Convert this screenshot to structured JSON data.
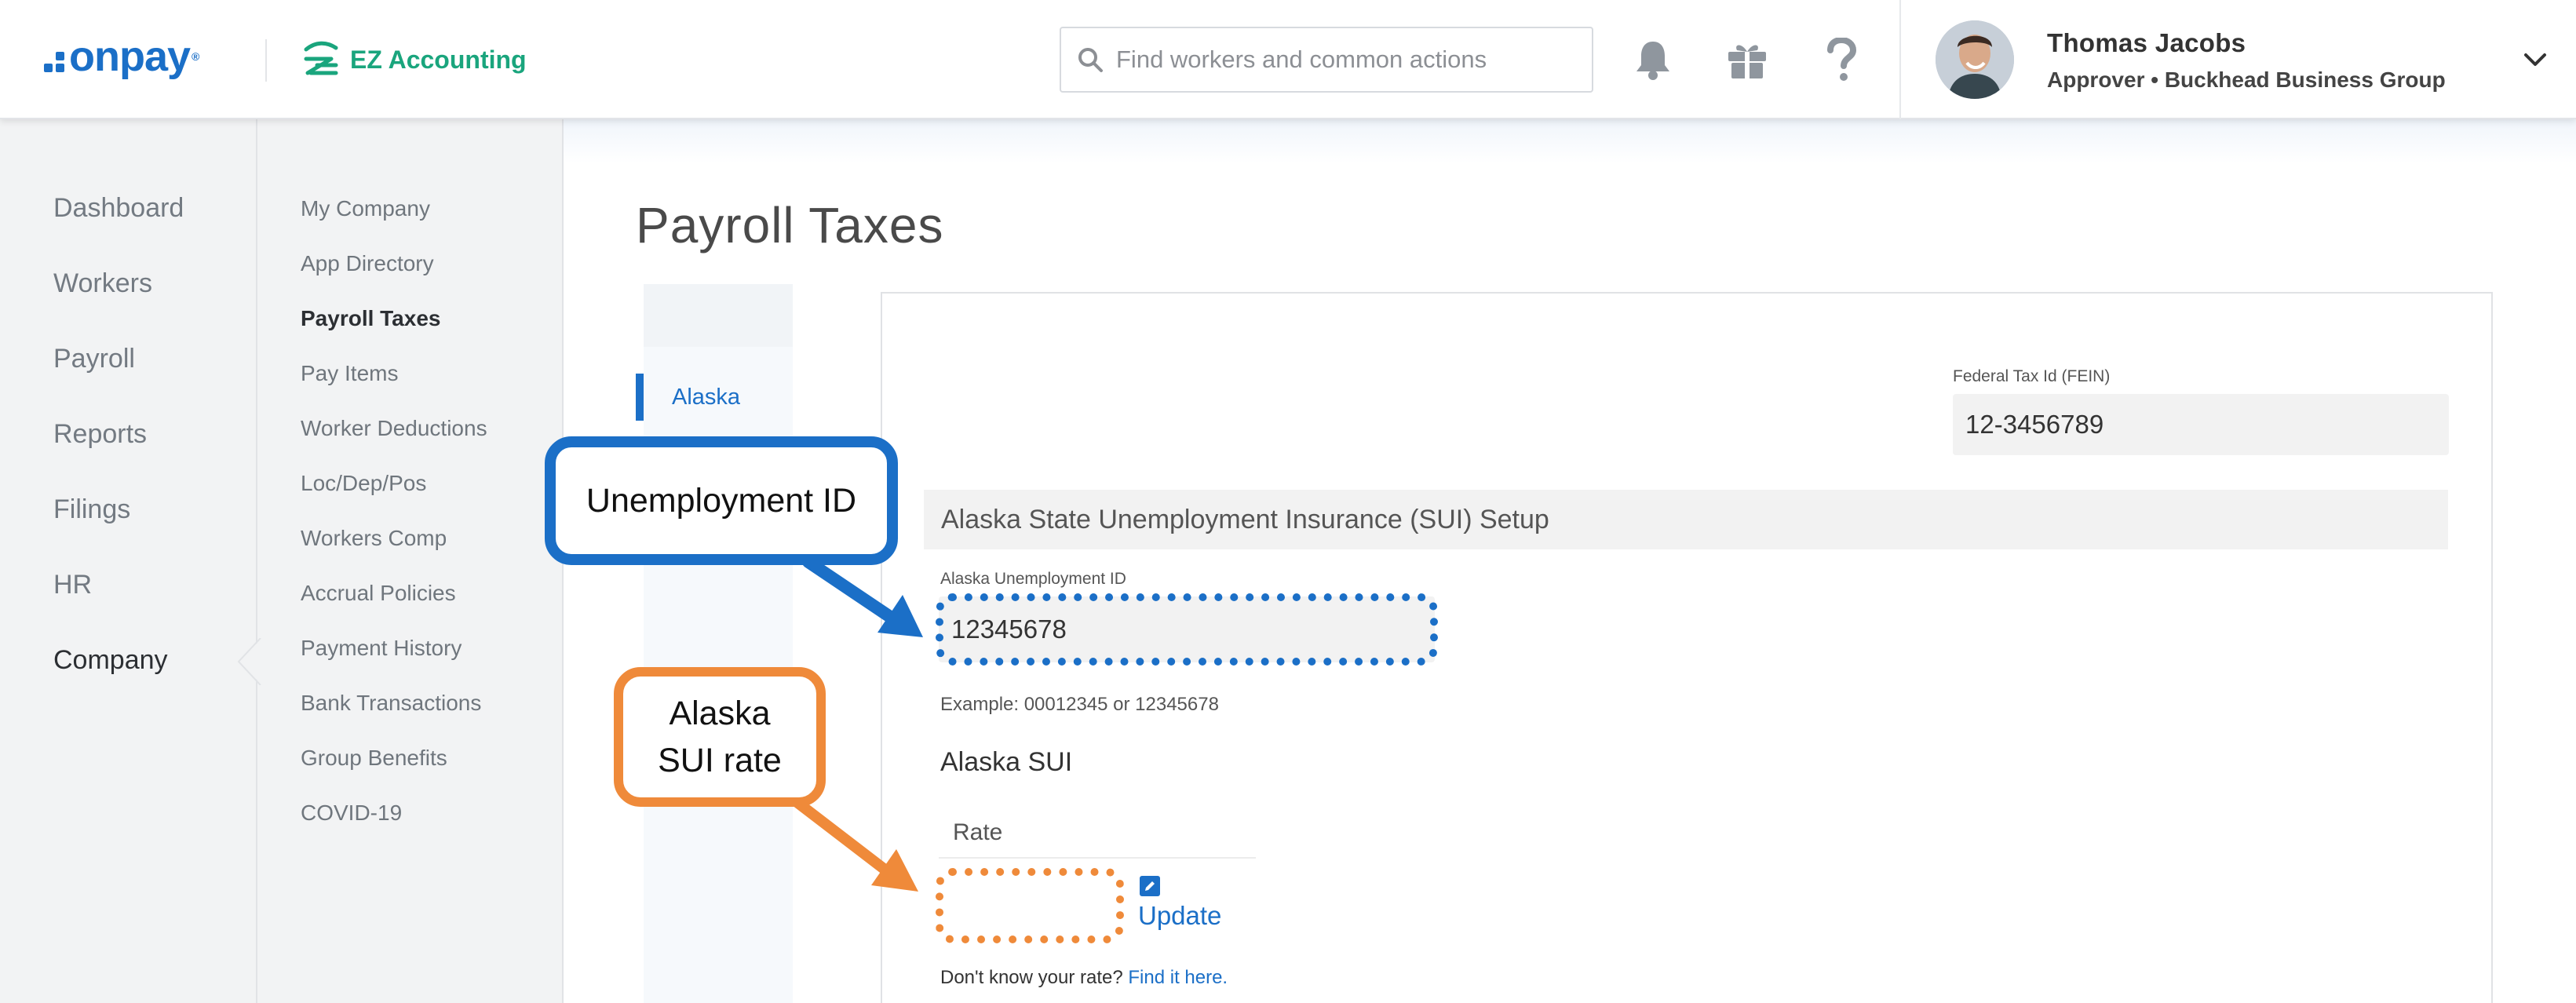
{
  "header": {
    "brand_name": "onpay",
    "brand_reg": "®",
    "product_name": "EZ Accounting",
    "search": {
      "placeholder": "Find workers and common actions",
      "value": ""
    },
    "icons": [
      "search-icon",
      "bell-icon",
      "gift-icon",
      "help-icon",
      "chevron-down-icon"
    ],
    "user": {
      "name": "Thomas Jacobs",
      "role": "Approver • Buckhead Business Group"
    }
  },
  "main_nav": {
    "items": [
      {
        "label": "Dashboard",
        "active": false
      },
      {
        "label": "Workers",
        "active": false
      },
      {
        "label": "Payroll",
        "active": false
      },
      {
        "label": "Reports",
        "active": false
      },
      {
        "label": "Filings",
        "active": false
      },
      {
        "label": "HR",
        "active": false
      },
      {
        "label": "Company",
        "active": true
      }
    ]
  },
  "sub_nav": {
    "items": [
      {
        "label": "My Company",
        "active": false
      },
      {
        "label": "App Directory",
        "active": false
      },
      {
        "label": "Payroll Taxes",
        "active": true
      },
      {
        "label": "Pay Items",
        "active": false
      },
      {
        "label": "Worker Deductions",
        "active": false
      },
      {
        "label": "Loc/Dep/Pos",
        "active": false
      },
      {
        "label": "Workers Comp",
        "active": false
      },
      {
        "label": "Accrual Policies",
        "active": false
      },
      {
        "label": "Payment History",
        "active": false
      },
      {
        "label": "Bank Transactions",
        "active": false
      },
      {
        "label": "Group Benefits",
        "active": false
      },
      {
        "label": "COVID-19",
        "active": false
      }
    ]
  },
  "page": {
    "title": "Payroll Taxes",
    "state_tab": "Alaska",
    "fein": {
      "label": "Federal Tax Id (FEIN)",
      "value": "12-3456789"
    },
    "section_title": "Alaska State Unemployment Insurance (SUI) Setup",
    "unemployment_id": {
      "label": "Alaska Unemployment ID",
      "value": "12345678",
      "example": "Example: 00012345 or 12345678"
    },
    "sui": {
      "title": "Alaska SUI",
      "rate_header": "Rate",
      "rate_value": "",
      "update_label": "Update",
      "help_prefix": "Don't know your rate?",
      "help_link": "Find it here."
    }
  },
  "callouts": {
    "unemployment_id": "Unemployment ID",
    "sui_rate_line1": "Alaska",
    "sui_rate_line2": "SUI rate"
  },
  "colors": {
    "brand_blue": "#1b6fc7",
    "ez_green": "#1aa57d",
    "callout_orange": "#ef8a3a"
  }
}
